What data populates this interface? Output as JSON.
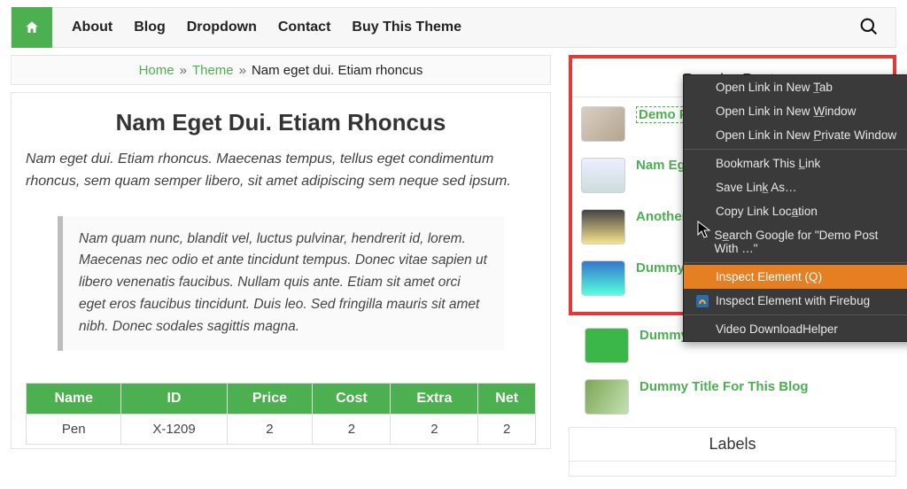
{
  "nav": {
    "items": [
      "About",
      "Blog",
      "Dropdown",
      "Contact",
      "Buy This Theme"
    ]
  },
  "breadcrumb": {
    "home": "Home",
    "theme": "Theme",
    "current": "Nam eget dui. Etiam rhoncus"
  },
  "article": {
    "title": "Nam Eget Dui. Etiam Rhoncus",
    "lead": "Nam eget dui. Etiam rhoncus. Maecenas tempus, tellus eget condimentum rhoncus, sem quam semper libero, sit amet adipiscing sem neque sed ipsum.",
    "quote": "Nam quam nunc, blandit vel, luctus pulvinar, hendrerit id, lorem. Maecenas nec odio et ante tincidunt tempus. Donec vitae sapien ut libero venenatis faucibus. Nullam quis ante. Etiam sit amet orci eget eros faucibus tincidunt. Duis leo. Sed fringilla mauris sit amet nibh. Donec sodales sagittis magna."
  },
  "table": {
    "headers": [
      "Name",
      "ID",
      "Price",
      "Cost",
      "Extra",
      "Net"
    ],
    "rows": [
      [
        "Pen",
        "X-1209",
        "2",
        "2",
        "2",
        "2"
      ]
    ]
  },
  "sidebar": {
    "popular_title": "Popular Posts",
    "posts": [
      {
        "label": "Demo Post With Customization"
      },
      {
        "label": "Nam Eget"
      },
      {
        "label": "Another H"
      },
      {
        "label": "Dummy H"
      },
      {
        "label": "Dummy Headline"
      },
      {
        "label": "Dummy Title For This Blog"
      }
    ],
    "labels_title": "Labels"
  },
  "context_menu": {
    "items": [
      {
        "label": "Open Link in New Tab"
      },
      {
        "label": "Open Link in New Window"
      },
      {
        "label": "Open Link in New Private Window"
      },
      {
        "sep": true
      },
      {
        "label": "Bookmark This Link"
      },
      {
        "label": "Save Link As…"
      },
      {
        "label": "Copy Link Location"
      },
      {
        "label": "Search Google for \"Demo Post With …\""
      },
      {
        "sep": true
      },
      {
        "label": "Inspect Element (Q)",
        "hover": true
      },
      {
        "label": "Inspect Element with Firebug",
        "icon": "firebug"
      },
      {
        "sep": true
      },
      {
        "label": "Video DownloadHelper"
      }
    ]
  }
}
